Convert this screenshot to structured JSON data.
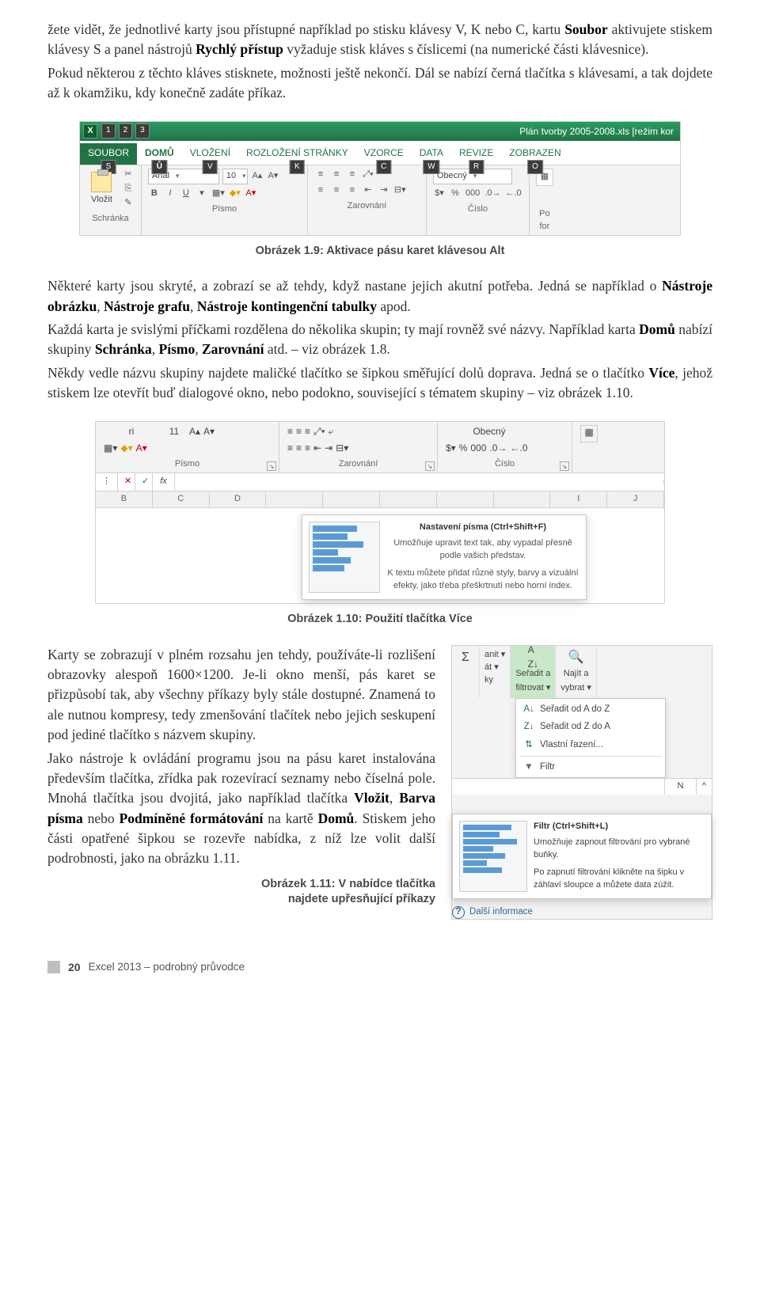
{
  "paragraphs": {
    "p1_a": "žete vidět, že jednotlivé karty jsou přístupné například po stisku klávesy V, K nebo C, kartu ",
    "p1_b": "Soubor",
    "p1_c": " aktivujete stiskem klávesy S a panel nástrojů ",
    "p1_d": "Rychlý přístup",
    "p1_e": " vyžaduje stisk kláves s číslicemi (na numerické části klávesnice).",
    "p2": "Pokud některou z těchto kláves stisknete, možnosti ještě nekončí. Dál se nabízí černá tlačítka s klávesami, a tak dojdete až k okamžiku, kdy konečně zadáte příkaz.",
    "fig19_caption": "Obrázek 1.9: Aktivace pásu karet klávesou Alt",
    "p3_a": "Některé karty jsou skryté, a zobrazí se až tehdy, když nastane jejich akutní potřeba. Jedná se například o ",
    "p3_b": "Nástroje obrázku",
    "p3_c": ", ",
    "p3_d": "Nástroje grafu",
    "p3_e": ", ",
    "p3_f": "Nástroje kontingenční tabulky",
    "p3_g": " apod.",
    "p4_a": "Každá karta je svislými příčkami rozdělena do několika skupin; ty mají rovněž své názvy. Například karta ",
    "p4_b": "Domů",
    "p4_c": " nabízí skupiny ",
    "p4_d": "Schránka",
    "p4_e": ", ",
    "p4_f": "Písmo",
    "p4_g": ", ",
    "p4_h": "Zarovnání",
    "p4_i": " atd. – viz obrázek 1.8.",
    "p5_a": "Někdy vedle názvu skupiny najdete maličké tlačítko se šipkou směřující dolů doprava. Jedná se o tlačítko ",
    "p5_b": "Více",
    "p5_c": ", jehož stiskem lze otevřít buď dialogové okno, nebo podokno, související s tématem skupiny – viz obrázek 1.10.",
    "fig110_caption": "Obrázek 1.10: Použití tlačítka Více",
    "p6": "Karty se zobrazují v plném rozsahu jen tehdy, používáte-li rozlišení obrazovky alespoň 1600×1200. Je-li okno menší, pás karet se přizpůsobí tak, aby všechny příkazy byly stále dostupné. Znamená to ale nutnou kompresy, tedy zmenšování tlačítek nebo jejich seskupení pod jediné tlačítko s názvem skupiny.",
    "p7_a": "Jako nástroje k ovládání programu jsou na pásu karet instalována především tlačítka, zřídka pak rozevírací seznamy nebo číselná pole. Mnohá tlačítka jsou dvojitá, jako například tlačítka ",
    "p7_b": "Vložit",
    "p7_c": ", ",
    "p7_d": "Barva písma",
    "p7_e": " nebo ",
    "p7_f": "Podmíněné formátování",
    "p7_g": " na kartě ",
    "p7_h": "Domů",
    "p7_i": ". Stiskem jeho části opatřené šipkou se rozevře nabídka, z níž lze volit další podrobnosti, jako na obrázku 1.11.",
    "fig111_caption_l1": "Obrázek 1.11: V nabídce tlačítka",
    "fig111_caption_l2": "najdete upřesňující příkazy"
  },
  "ribbon19": {
    "title": "Plán tvorby 2005-2008.xls  [režim kor",
    "qat_keytips": [
      "1",
      "2",
      "3"
    ],
    "tabs": [
      {
        "label": "SOUBOR",
        "key": "S"
      },
      {
        "label": "DOMŮ",
        "key": "Ů"
      },
      {
        "label": "VLOŽENÍ",
        "key": "V"
      },
      {
        "label": "ROZLOŽENÍ STRÁNKY",
        "key": "K"
      },
      {
        "label": "VZORCE",
        "key": "C"
      },
      {
        "label": "DATA",
        "key": "W"
      },
      {
        "label": "REVIZE",
        "key": "R"
      },
      {
        "label": "ZOBRAZEN",
        "key": "O"
      }
    ],
    "paste_label": "Vložit",
    "font_name": "Arial",
    "font_size": "10",
    "number_format": "Obecný",
    "groups": [
      "Schránka",
      "Písmo",
      "Zarovnání",
      "Číslo"
    ],
    "bold": "B",
    "italic": "I",
    "underline": "U",
    "last_label": "Po\nfor"
  },
  "ribbon110": {
    "font_name": "ri",
    "font_size": "11",
    "number_format": "Obecný",
    "groups": [
      "Písmo",
      "Zarovnání",
      "Číslo"
    ],
    "fx": "fx",
    "cols": [
      "B",
      "C",
      "D",
      "",
      "",
      "",
      "",
      "",
      "I",
      "J"
    ],
    "tooltip_title": "Nastavení písma (Ctrl+Shift+F)",
    "tooltip_p1": "Umožňuje upravit text tak, aby vypadal přesně podle vašich představ.",
    "tooltip_p2": "K textu můžete přidat různé styly, barvy a vizuální efekty, jako třeba přeškrtnutí nebo horní index."
  },
  "fig111": {
    "top_items": [
      {
        "icon": "Σ",
        "label": "",
        "sub": ""
      },
      {
        "icon": "⬇",
        "label": "anit ▾"
      },
      {
        "icon": "A↓Z",
        "label": "Seřadit a",
        "sub": "filtrovat ▾",
        "hl": true
      },
      {
        "icon": "🔍",
        "label": "Najít a",
        "sub": "vybrat ▾"
      }
    ],
    "side_items": [
      "át ▾",
      "ky"
    ],
    "menu": [
      {
        "icon": "A↓Z",
        "label": "Seřadit od A do Z"
      },
      {
        "icon": "Z↓A",
        "label": "Seřadit od Z do A"
      },
      {
        "icon": "⇅",
        "label": "Vlastní řazení..."
      },
      {
        "sep": true
      },
      {
        "icon": "▼",
        "label": "Filtr"
      }
    ],
    "col_n": "N",
    "tooltip_title": "Filtr (Ctrl+Shift+L)",
    "tooltip_p1": "Umožňuje zapnout filtrování pro vybrané buňky.",
    "tooltip_p2": "Po zapnutí filtrování klikněte na šipku v záhlaví sloupce a můžete data zúžit.",
    "more": "Další informace",
    "caret": "^"
  },
  "footer": {
    "page": "20",
    "book": "Excel 2013 – podrobný průvodce"
  }
}
